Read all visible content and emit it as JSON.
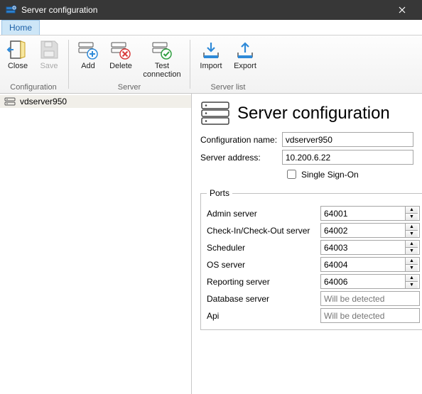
{
  "window": {
    "title": "Server configuration"
  },
  "tabs": {
    "home": "Home"
  },
  "ribbon": {
    "close": "Close",
    "save": "Save",
    "add": "Add",
    "delete": "Delete",
    "test": "Test connection",
    "import": "Import",
    "export": "Export",
    "group_config": "Configuration",
    "group_server": "Server",
    "group_list": "Server list"
  },
  "tree": {
    "item0": "vdserver950"
  },
  "main": {
    "heading": "Server configuration",
    "labels": {
      "cfgname": "Configuration name:",
      "address": "Server address:",
      "sso": "Single Sign-On",
      "ports_legend": "Ports",
      "admin": "Admin server",
      "cico": "Check-In/Check-Out server",
      "sched": "Scheduler",
      "os": "OS server",
      "report": "Reporting server",
      "db": "Database server",
      "api": "Api"
    },
    "values": {
      "cfgname": "vdserver950",
      "address": "10.200.6.22",
      "admin": "64001",
      "cico": "64002",
      "sched": "64003",
      "os": "64004",
      "report": "64006"
    },
    "placeholders": {
      "detected": "Will be detected"
    }
  }
}
